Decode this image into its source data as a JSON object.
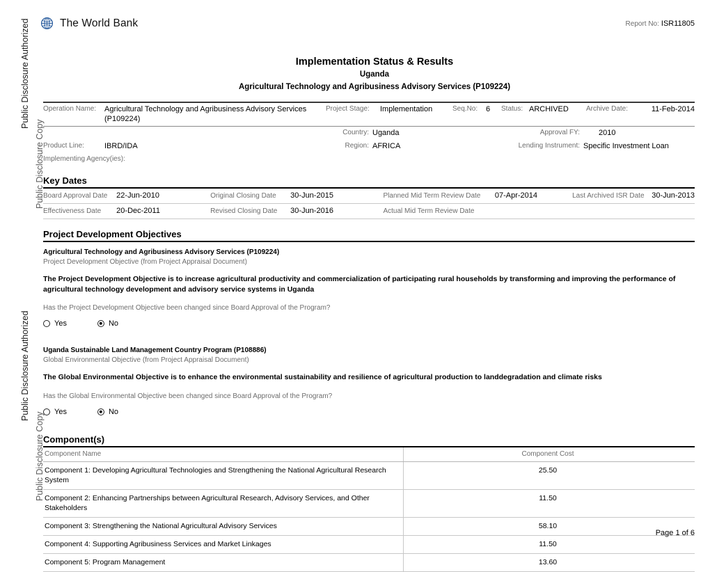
{
  "disclosure_strip": {
    "authorized_label": "Public Disclosure Authorized",
    "copy_label": "Public Disclosure Copy"
  },
  "header": {
    "brand": "The World Bank",
    "report_no_label": "Report No:",
    "report_no_value": "ISR11805",
    "logo_color": "#2a5d9e"
  },
  "title_block": {
    "line1": "Implementation Status & Results",
    "line2": "Uganda",
    "line3": "Agricultural Technology and Agribusiness Advisory Services (P109224)"
  },
  "operation": {
    "operation_name_label": "Operation Name:",
    "operation_name_value": "Agricultural Technology and Agribusiness Advisory Services",
    "operation_name_value2": "(P109224)",
    "project_stage_label": "Project Stage:",
    "project_stage_value": "Implementation",
    "seq_no_label": "Seq.No:",
    "seq_no_value": "6",
    "status_label": "Status:",
    "status_value": "ARCHIVED",
    "archive_date_label": "Archive Date:",
    "archive_date_value": "11-Feb-2014",
    "country_label": "Country:",
    "country_value": "Uganda",
    "approval_fy_label": "Approval FY:",
    "approval_fy_value": "2010",
    "product_line_label": "Product Line:",
    "product_line_value": "IBRD/IDA",
    "region_label": "Region:",
    "region_value": "AFRICA",
    "lending_instrument_label": "Lending Instrument:",
    "lending_instrument_value": "Specific Investment Loan",
    "implementing_agency_label": "Implementing Agency(ies):",
    "implementing_agency_value": ""
  },
  "key_dates": {
    "heading": "Key Dates",
    "board_approval_label": "Board Approval Date",
    "board_approval_value": "22-Jun-2010",
    "original_closing_label": "Original Closing Date",
    "original_closing_value": "30-Jun-2015",
    "planned_mtr_label": "Planned Mid Term Review Date",
    "planned_mtr_value": "07-Apr-2014",
    "last_archived_isr_label": "Last Archived ISR Date",
    "last_archived_isr_value": "30-Jun-2013",
    "effectiveness_label": "Effectiveness Date",
    "effectiveness_value": "20-Dec-2011",
    "revised_closing_label": "Revised Closing Date",
    "revised_closing_value": "30-Jun-2016",
    "actual_mtr_label": "Actual Mid Term Review Date",
    "actual_mtr_value": ""
  },
  "pdo": {
    "heading": "Project Development Objectives",
    "project_title": "Agricultural Technology and Agribusiness Advisory Services (P109224)",
    "subtitle": "Project Development Objective (from Project Appraisal Document)",
    "objective_text": "The Project Development Objective is to increase agricultural productivity and commercialization of participating rural households by transforming and improving the performance of agricultural technology development and advisory service systems in Uganda",
    "question": "Has the Project Development Objective been changed since Board Approval of the Program?",
    "yes_label": "Yes",
    "no_label": "No",
    "selected": "No"
  },
  "geo": {
    "project_title": "Uganda Sustainable Land Management Country Program (P108886)",
    "subtitle": "Global Environmental Objective (from Project Appraisal Document)",
    "objective_text": "The Global Environmental Objective is to enhance the environmental sustainability and resilience of agricultural production to landdegradation and climate risks",
    "question": "Has the Global Environmental Objective been changed since Board Approval of the Program?",
    "yes_label": "Yes",
    "no_label": "No",
    "selected": "No"
  },
  "components": {
    "heading": "Component(s)",
    "col_name": "Component Name",
    "col_cost": "Component Cost",
    "rows": [
      {
        "name": "Component 1: Developing Agricultural Technologies and Strengthening the National Agricultural Research System",
        "cost": "25.50"
      },
      {
        "name": "Component 2: Enhancing Partnerships between Agricultural Research, Advisory Services, and Other Stakeholders",
        "cost": "11.50"
      },
      {
        "name": "Component 3: Strengthening the National Agricultural Advisory Services",
        "cost": "58.10"
      },
      {
        "name": "Component 4: Supporting Agribusiness Services and Market Linkages",
        "cost": "11.50"
      },
      {
        "name": "Component 5: Program Management",
        "cost": "13.60"
      }
    ]
  },
  "footer": {
    "page_label": "Page 1 of 6"
  }
}
